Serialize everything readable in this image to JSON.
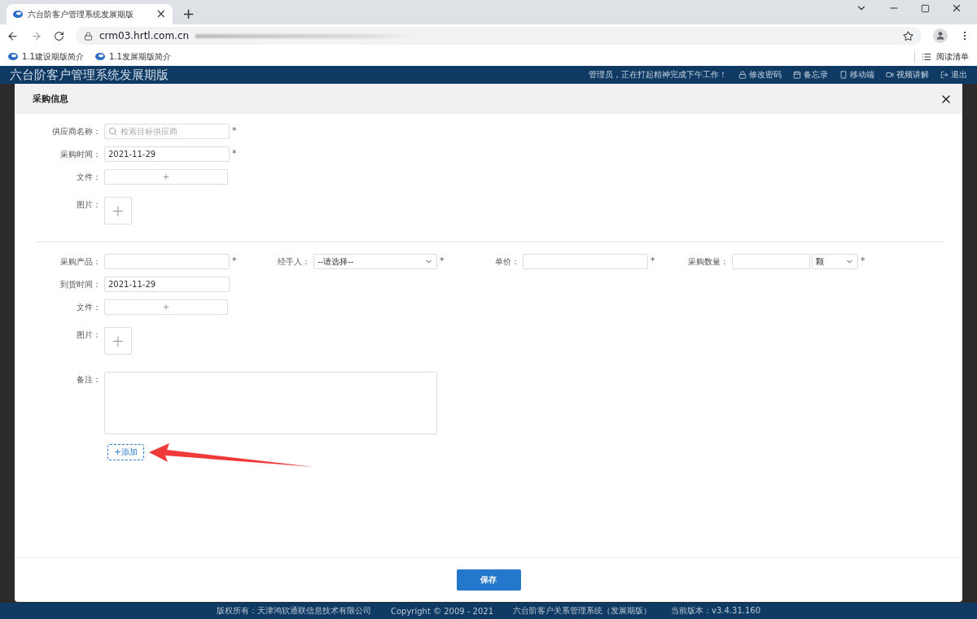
{
  "browser": {
    "tab_title": "六台阶客户管理系统发展期版",
    "tab_close": "×",
    "new_tab": "+",
    "url": "crm03.hrtl.com.cn",
    "bookmarks": [
      "1.1建设期版简介",
      "1.1发展期版简介"
    ],
    "reading_list": "阅读清单"
  },
  "app_header": {
    "title": "六台阶客户管理系统发展期版",
    "greeting": "管理员，正在打起精神完成下午工作！",
    "links": [
      {
        "kind": "password",
        "label": "修改密码"
      },
      {
        "kind": "memo",
        "label": "备忘录"
      },
      {
        "kind": "mobile",
        "label": "移动端"
      },
      {
        "kind": "video",
        "label": "视频讲解"
      },
      {
        "kind": "logout",
        "label": "退出"
      }
    ]
  },
  "dialog": {
    "title": "采购信息",
    "supplier_fields": [
      {
        "kind": "search",
        "label": "供应商名称：",
        "placeholder": "检索目标供应商",
        "required_mark": "*"
      },
      {
        "kind": "text",
        "label": "采购时间：",
        "value": "2021-11-29",
        "required_mark": "*"
      },
      {
        "kind": "file",
        "label": "文件：",
        "button": "+"
      },
      {
        "kind": "image",
        "label": "图片：",
        "button": "+"
      }
    ],
    "product_row": [
      {
        "kind": "text",
        "label": "采购产品：",
        "required_mark": "*"
      },
      {
        "kind": "select",
        "label": "经手人：",
        "value": "--请选择--",
        "required_mark": "*"
      },
      {
        "kind": "text",
        "label": "单价：",
        "required_mark": "*"
      },
      {
        "kind": "quantity",
        "label": "采购数量：",
        "unit": "颗",
        "required_mark": "*"
      }
    ],
    "product_fields": [
      {
        "kind": "text",
        "label": "到货时间：",
        "value": "2021-11-29"
      },
      {
        "kind": "file",
        "label": "文件：",
        "button": "+"
      },
      {
        "kind": "image",
        "label": "图片：",
        "button": "+"
      },
      {
        "kind": "textarea",
        "label": "备注："
      }
    ],
    "add_button": "+添加",
    "save_button": "保存"
  },
  "footer": [
    "版权所有：天津鸿软通联信息技术有限公司",
    "Copyright © 2009 - 2021",
    "六台阶客户关系管理系统（发展期版）",
    "当前版本：v3.4.31.160"
  ]
}
